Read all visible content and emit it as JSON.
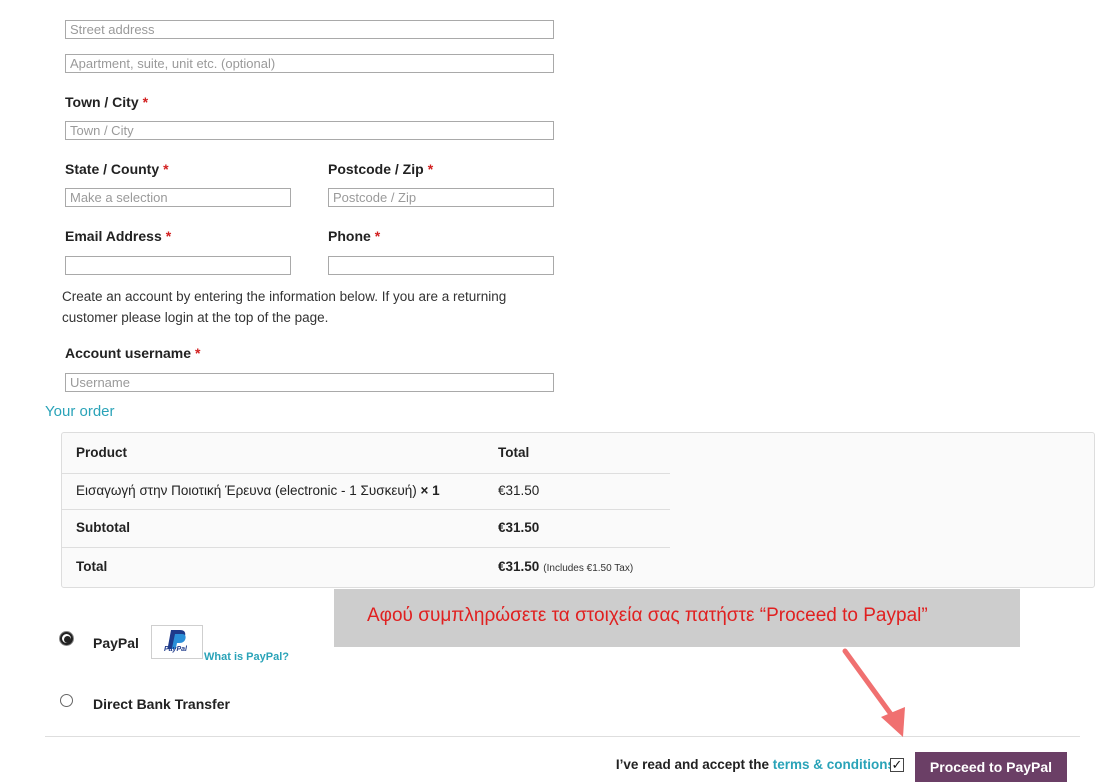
{
  "billing": {
    "street_placeholder": "Street address",
    "apartment_placeholder": "Apartment, suite, unit etc. (optional)",
    "town_label": "Town / City",
    "town_placeholder": "Town / City",
    "state_label": "State / County",
    "state_placeholder": "Make a selection",
    "postcode_label": "Postcode / Zip",
    "postcode_placeholder": "Postcode / Zip",
    "email_label": "Email Address",
    "phone_label": "Phone",
    "required_mark": "*"
  },
  "account": {
    "note_line1": "Create an account by entering the information below. If you are a returning",
    "note_line2": "customer please login at the top of the page.",
    "username_label": "Account username",
    "username_placeholder": "Username"
  },
  "order": {
    "heading": "Your order",
    "col_product": "Product",
    "col_total": "Total",
    "item_name": "Εισαγωγή στην Ποιοτική Έρευνα (electronic - 1 Συσκευή)",
    "item_qty": "× 1",
    "item_total": "€31.50",
    "subtotal_label": "Subtotal",
    "subtotal_value": "€31.50",
    "total_label": "Total",
    "total_value": "€31.50",
    "total_tax_note": "(Includes €1.50 Tax)"
  },
  "callout": {
    "text": "Αφού συμπληρώσετε τα στοιχεία σας πατήστε “Proceed to Paypal”",
    "text_color": "#e02020",
    "arrow_color": "#f07070"
  },
  "payment": {
    "paypal_label": "PayPal",
    "paypal_logo_text": "PayPal",
    "what_is_paypal": "What is PayPal?",
    "bank_label": "Direct Bank Transfer",
    "selected": "paypal"
  },
  "footer": {
    "accept_prefix": "I’ve read and accept the",
    "terms_link": "terms & conditions",
    "terms_checked": true,
    "proceed_button": "Proceed to PayPal",
    "button_color": "#6b3f66"
  }
}
